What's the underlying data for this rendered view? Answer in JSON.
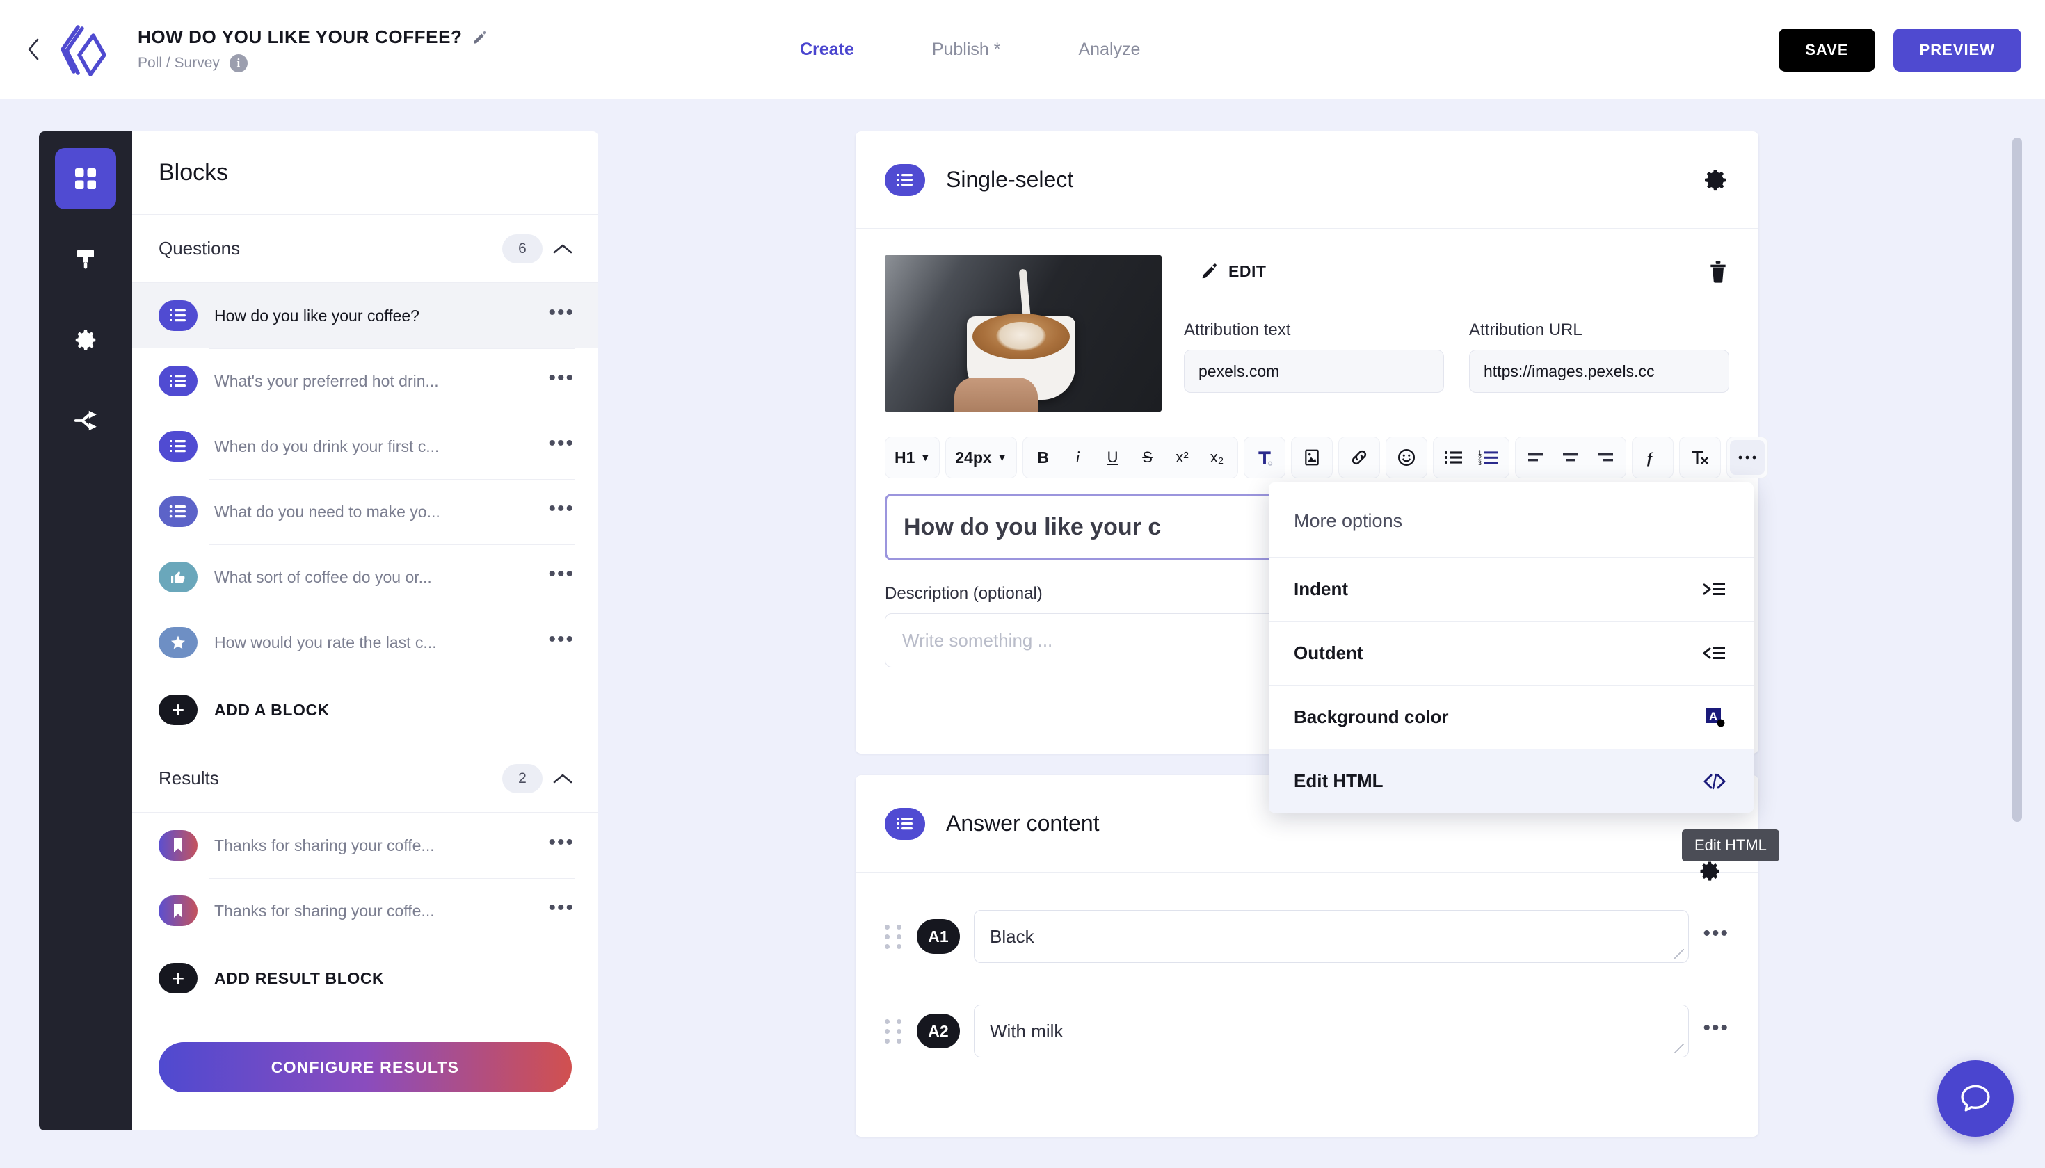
{
  "header": {
    "back_icon": "chevron-left-icon",
    "logo_icon": "brand-logo-icon",
    "project_title": "HOW DO YOU LIKE YOUR COFFEE?",
    "edit_title_icon": "pencil-icon",
    "project_subtitle": "Poll / Survey",
    "info_icon": "info-icon",
    "info_glyph": "i",
    "nav": [
      {
        "label": "Create",
        "active": true
      },
      {
        "label": "Publish *",
        "active": false
      },
      {
        "label": "Analyze",
        "active": false
      }
    ],
    "save_label": "SAVE",
    "preview_label": "PREVIEW",
    "accent_color": "#4f4ad0",
    "save_color": "#000000"
  },
  "rail": {
    "items": [
      {
        "icon": "grid-blocks-icon",
        "active": true
      },
      {
        "icon": "paint-brush-icon",
        "active": false
      },
      {
        "icon": "gear-icon",
        "active": false
      },
      {
        "icon": "share-nodes-icon",
        "active": false
      }
    ]
  },
  "blocks_panel": {
    "title": "Blocks",
    "questions_section": {
      "label": "Questions",
      "count": "6",
      "collapse_icon": "chevron-up-icon",
      "items": [
        {
          "icon": "list-single-select-icon",
          "label": "How do you like your coffee?",
          "selected": true,
          "color": "#504bd2",
          "menu_icon": "more-dots-icon"
        },
        {
          "icon": "list-single-select-icon",
          "label": "What's your preferred hot drin...",
          "selected": false,
          "color": "#504bd2",
          "menu_icon": "more-dots-icon"
        },
        {
          "icon": "list-single-select-icon",
          "label": "When do you drink your first c...",
          "selected": false,
          "color": "#504bd2",
          "menu_icon": "more-dots-icon"
        },
        {
          "icon": "list-multi-select-icon",
          "label": "What do you need to make yo...",
          "selected": false,
          "color": "#5c63c8",
          "menu_icon": "more-dots-icon"
        },
        {
          "icon": "thumbs-up-icon",
          "label": "What sort of coffee do you or...",
          "selected": false,
          "color": "#6aa7bb",
          "menu_icon": "more-dots-icon"
        },
        {
          "icon": "star-icon",
          "label": "How would you rate the last c...",
          "selected": false,
          "color": "#6e8fc4",
          "menu_icon": "more-dots-icon"
        }
      ],
      "add_label": "ADD A BLOCK",
      "add_icon": "plus-icon"
    },
    "results_section": {
      "label": "Results",
      "count": "2",
      "collapse_icon": "chevron-up-icon",
      "items": [
        {
          "icon": "bookmark-icon",
          "label": "Thanks for sharing your coffe...",
          "menu_icon": "more-dots-icon"
        },
        {
          "icon": "bookmark-icon",
          "label": "Thanks for sharing your coffe...",
          "menu_icon": "more-dots-icon"
        }
      ],
      "add_label": "ADD RESULT BLOCK",
      "add_icon": "plus-icon"
    },
    "configure_label": "CONFIGURE RESULTS"
  },
  "question_card": {
    "type_icon": "list-single-select-icon",
    "title": "Single-select",
    "settings_icon": "gear-icon",
    "image_alt": "barista-pouring-latte-photo",
    "edit_label": "EDIT",
    "edit_icon": "pencil-icon",
    "delete_icon": "trash-icon",
    "attribution_text_label": "Attribution text",
    "attribution_text_value": "pexels.com",
    "attribution_url_label": "Attribution URL",
    "attribution_url_value": "https://images.pexels.cc",
    "toolbar": {
      "heading_value": "H1",
      "font_size_value": "24px",
      "bold": "B",
      "italic": "i",
      "underline": "U",
      "strikethrough": "S",
      "superscript": "x²",
      "subscript": "x₂",
      "text_color_icon": "text-color-icon",
      "insert_image_icon": "image-icon",
      "link_icon": "link-icon",
      "emoji_icon": "emoji-icon",
      "bullet_list_icon": "bullet-list-icon",
      "numbered_list_icon": "numbered-list-icon",
      "align_left_icon": "align-left-icon",
      "align_center_icon": "align-center-icon",
      "align_right_icon": "align-right-icon",
      "formula_icon": "formula-icon",
      "clear_format_icon": "clear-formatting-icon",
      "more_icon": "more-dots-icon"
    },
    "question_value": "How do you like your c",
    "description_label": "Description (optional)",
    "description_placeholder": "Write something ..."
  },
  "more_options_menu": {
    "heading": "More options",
    "items": [
      {
        "label": "Indent",
        "icon": "indent-icon",
        "highlighted": false
      },
      {
        "label": "Outdent",
        "icon": "outdent-icon",
        "highlighted": false
      },
      {
        "label": "Background color",
        "icon": "background-color-icon",
        "highlighted": false
      },
      {
        "label": "Edit HTML",
        "icon": "code-brackets-icon",
        "highlighted": true
      }
    ]
  },
  "tooltip": {
    "text": "Edit HTML"
  },
  "answer_card": {
    "type_icon": "list-single-select-icon",
    "title": "Answer content",
    "rows": [
      {
        "grip_icon": "drag-handle-icon",
        "badge": "A1",
        "value": "Black",
        "menu_icon": "more-dots-icon"
      },
      {
        "grip_icon": "drag-handle-icon",
        "badge": "A2",
        "value": "With milk",
        "menu_icon": "more-dots-icon"
      }
    ]
  },
  "chat_fab": {
    "icon": "chat-bubble-icon",
    "color": "#4a45cf"
  },
  "scrollbar": {
    "name": "vertical-scrollbar"
  }
}
